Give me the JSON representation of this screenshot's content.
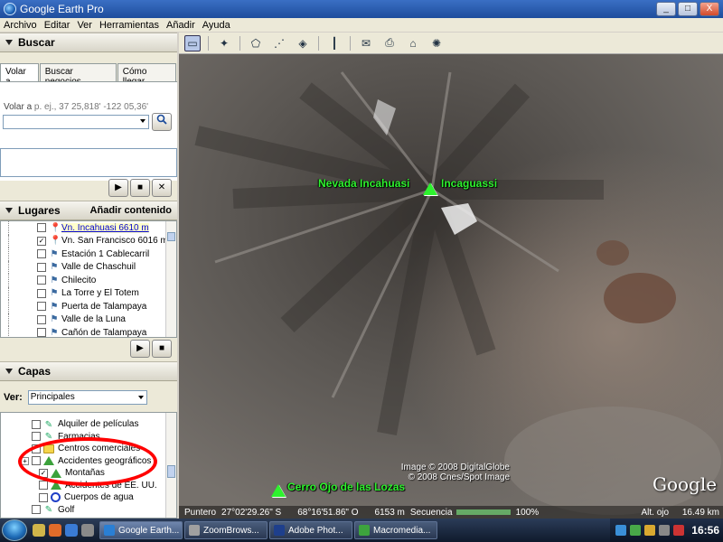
{
  "window": {
    "title": "Google Earth Pro",
    "buttons": [
      "_",
      "□",
      "X"
    ]
  },
  "menu": [
    "Archivo",
    "Editar",
    "Ver",
    "Herramientas",
    "Añadir",
    "Ayuda"
  ],
  "buscar": {
    "header": "Buscar",
    "tabs": [
      "Volar a",
      "Buscar negocios",
      "Cómo llegar"
    ],
    "hint_label": "Volar a",
    "hint_example": "p. ej., 37 25,818' -122 05,36'",
    "input_value": ""
  },
  "lugares": {
    "header": "Lugares",
    "add_content": "Añadir contenido",
    "items": [
      {
        "label": "Vn. Incahuasi 6610 m",
        "checked": false,
        "pin": "red",
        "link": true
      },
      {
        "label": "Vn. San Francisco 6016 m",
        "checked": true,
        "pin": "red",
        "link": false
      },
      {
        "label": "Estación 1 Cablecarril",
        "checked": false,
        "pin": "blue",
        "link": false
      },
      {
        "label": "Valle de Chaschuil",
        "checked": false,
        "pin": "blue",
        "link": false
      },
      {
        "label": "Chilecito",
        "checked": false,
        "pin": "blue",
        "link": false
      },
      {
        "label": "La Torre y El Totem",
        "checked": false,
        "pin": "blue",
        "link": false
      },
      {
        "label": "Puerta de Talampaya",
        "checked": false,
        "pin": "blue",
        "link": false
      },
      {
        "label": "Valle de la Luna",
        "checked": false,
        "pin": "blue",
        "link": false
      },
      {
        "label": "Cañón de Talampaya",
        "checked": false,
        "pin": "blue",
        "link": false
      }
    ]
  },
  "capas": {
    "header": "Capas",
    "ver_label": "Ver:",
    "ver_value": "Principales",
    "items": [
      {
        "label": "Alquiler de películas",
        "icon": "pen"
      },
      {
        "label": "Farmacias",
        "icon": "pen"
      },
      {
        "label": "Centros comerciales",
        "icon": "folder"
      },
      {
        "label": "Accidentes geográficos",
        "icon": "tri"
      },
      {
        "label": "Montañas",
        "icon": "tri"
      },
      {
        "label": "Accidentes de EE. UU.",
        "icon": "tri"
      },
      {
        "label": "Cuerpos de agua",
        "icon": "ring"
      },
      {
        "label": "Golf",
        "icon": "pen"
      }
    ]
  },
  "map": {
    "labels": [
      {
        "text": "Nevada Incahuasi"
      },
      {
        "text": "Incaguassi"
      },
      {
        "text": "Cerro Ojo de las Lozas"
      }
    ],
    "credits": [
      "Image © 2008 DigitalGlobe",
      "© 2008 Cnes/Spot Image"
    ],
    "logo": "Google",
    "status": {
      "pointer": "Puntero",
      "lat": "27°02'29.26\" S",
      "lon": "68°16'51.86\" O",
      "elev": "6153 m",
      "stream_label": "Secuencia",
      "stream_pct": "100%",
      "stream_fraction": 1.0,
      "eye_label": "Alt. ojo",
      "eye_value": "16.49 km"
    }
  },
  "taskbar": {
    "tasks": [
      {
        "label": "Google Earth...",
        "color": "#2a7fd4",
        "active": true
      },
      {
        "label": "ZoomBrows...",
        "color": "#a0a0a0",
        "active": false
      },
      {
        "label": "Adobe Phot...",
        "color": "#1e3f8c",
        "active": false
      },
      {
        "label": "Macromedia...",
        "color": "#3da33d",
        "active": false
      }
    ],
    "clock": "16:56"
  }
}
